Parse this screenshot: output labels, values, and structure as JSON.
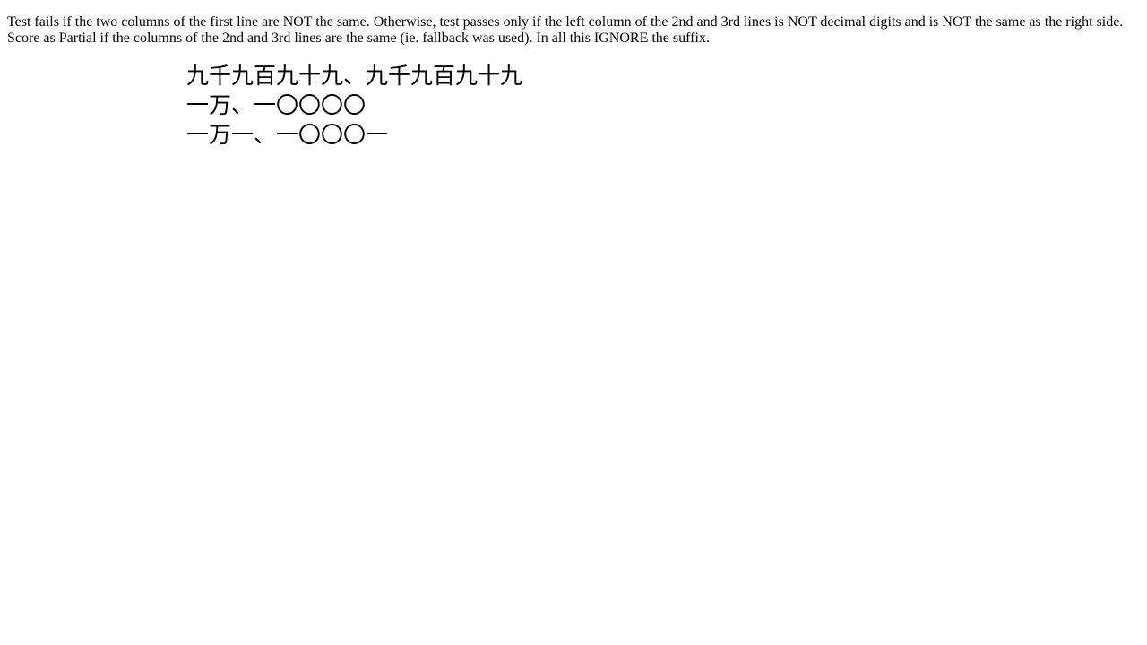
{
  "instructions": "Test fails if the two columns of the first line are NOT the same. Otherwise, test passes only if the left column of the 2nd and 3rd lines is NOT decimal digits and is NOT the same as the right side. Score as Partial if the columns of the 2nd and 3rd lines are the same (ie. fallback was used). In all this IGNORE the suffix.",
  "lines": [
    {
      "text": "九千九百九十九、九千九百九十九"
    },
    {
      "text": "一万、一〇〇〇〇"
    },
    {
      "text": "一万一、一〇〇〇一"
    }
  ]
}
